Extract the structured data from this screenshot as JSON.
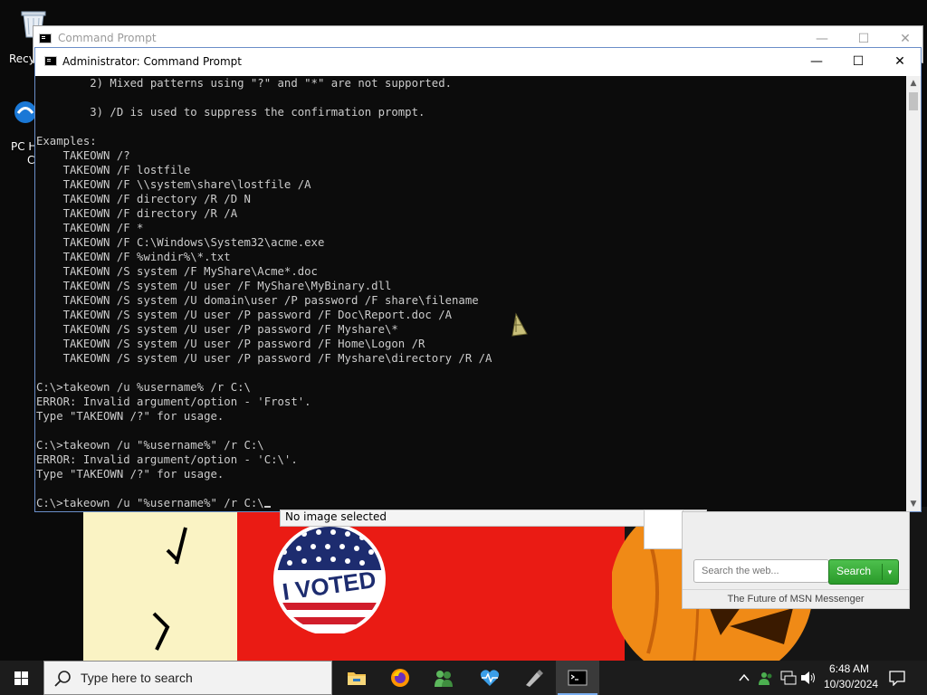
{
  "desktop": {
    "recycle_bin_label": "Recycle Bin",
    "pc_health_label_1": "PC H",
    "pc_health_label_2": "Ch"
  },
  "background_window": {
    "title": "Command Prompt"
  },
  "window": {
    "title": "Administrator: Command Prompt",
    "minimize_glyph": "—",
    "maximize_glyph": "☐",
    "close_glyph": "✕"
  },
  "console": {
    "lines": [
      "        2) Mixed patterns using \"?\" and \"*\" are not supported.",
      "",
      "        3) /D is used to suppress the confirmation prompt.",
      "",
      "Examples:",
      "    TAKEOWN /?",
      "    TAKEOWN /F lostfile",
      "    TAKEOWN /F \\\\system\\share\\lostfile /A",
      "    TAKEOWN /F directory /R /D N",
      "    TAKEOWN /F directory /R /A",
      "    TAKEOWN /F *",
      "    TAKEOWN /F C:\\Windows\\System32\\acme.exe",
      "    TAKEOWN /F %windir%\\*.txt",
      "    TAKEOWN /S system /F MyShare\\Acme*.doc",
      "    TAKEOWN /S system /U user /F MyShare\\MyBinary.dll",
      "    TAKEOWN /S system /U domain\\user /P password /F share\\filename",
      "    TAKEOWN /S system /U user /P password /F Doc\\Report.doc /A",
      "    TAKEOWN /S system /U user /P password /F Myshare\\*",
      "    TAKEOWN /S system /U user /P password /F Home\\Logon /R",
      "    TAKEOWN /S system /U user /P password /F Myshare\\directory /R /A",
      "",
      "C:\\>takeown /u %username% /r C:\\",
      "ERROR: Invalid argument/option - 'Frost'.",
      "Type \"TAKEOWN /?\" for usage.",
      "",
      "C:\\>takeown /u \"%username%\" /r C:\\",
      "ERROR: Invalid argument/option - 'C:\\'.",
      "Type \"TAKEOWN /?\" for usage.",
      "",
      "C:\\>takeown /u \"%username%\" /r C:\\"
    ]
  },
  "image_viewer": {
    "status": "No image selected"
  },
  "msn": {
    "search_placeholder": "Search the web...",
    "search_button": "Search",
    "search_arrow": "▾",
    "tagline": "The Future of MSN Messenger"
  },
  "wallpaper": {
    "sticker_text": "I VOTED"
  },
  "taskbar": {
    "search_placeholder": "Type here to search",
    "apps": [
      "file-explorer",
      "firefox",
      "msn-messenger",
      "health-monitor",
      "usb-tool",
      "command-prompt"
    ],
    "time": "6:48 AM",
    "date": "10/30/2024"
  },
  "colors": {
    "console_bg": "#0c0c0c",
    "console_text": "#cccccc",
    "taskbar_bg": "#1c1c1c",
    "msn_green": "#2a9a2a",
    "wallpaper_red": "#ea1b14",
    "wallpaper_yellow": "#faf3c4",
    "pumpkin_orange": "#f08a16"
  }
}
